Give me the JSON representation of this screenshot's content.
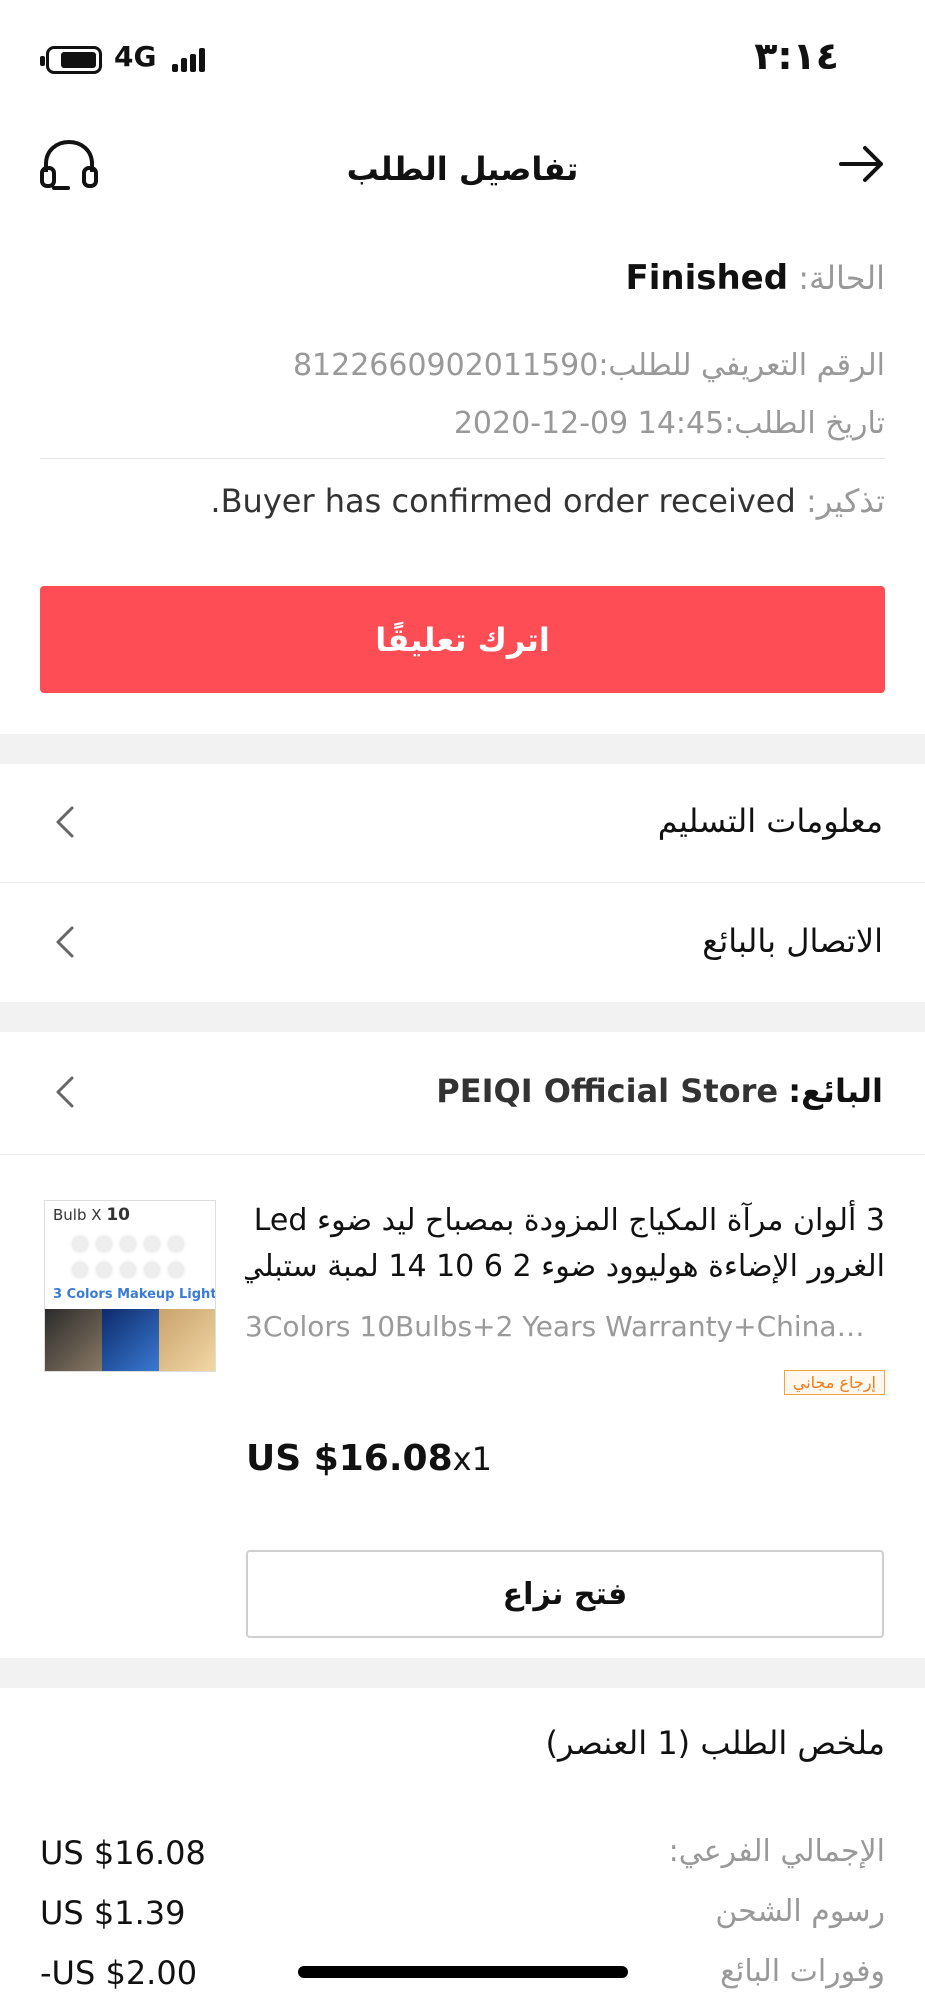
{
  "status_bar": {
    "network": "4G",
    "time": "٣:١٤"
  },
  "header": {
    "title": "تفاصيل الطلب"
  },
  "order": {
    "status_label": "الحالة:",
    "status_value": "Finished",
    "id_label": "الرقم التعريفي للطلب:",
    "id_value": "8122660902011590",
    "date_label": "تاريخ الطلب:",
    "date_value": "2020-12-09 14:45",
    "reminder_label": "تذكير:",
    "reminder_value": "Buyer has confirmed order received."
  },
  "actions": {
    "leave_feedback": "اترك تعليقًا",
    "open_dispute": "فتح نزاع"
  },
  "rows": {
    "delivery_info": "معلومات التسليم",
    "contact_seller": "الاتصال بالبائع"
  },
  "seller": {
    "label": "البائع:",
    "name": "PEIQI Official Store"
  },
  "product": {
    "image_label_prefix": "Bulb X",
    "image_label_count": "10",
    "image_colors_label": "3 Colors Makeup Light",
    "title_line1": "3 ألوان مرآة المكياج المزودة بمصباح ليد ضوء Led",
    "title_line2": "الغرور الإضاءة هوليوود ضوء 2 6 10 14 لمبة ستبلي...",
    "sku": "3Colors 10Bulbs+2 Years Warranty+China+P...",
    "badge": "إرجاع مجاني",
    "price": "US $16.08",
    "quantity": "x1"
  },
  "summary": {
    "title": "ملخص الطلب (1 العنصر)",
    "subtotal_label": "الإجمالي الفرعي:",
    "subtotal_value": "US $16.08",
    "shipping_label": "رسوم الشحن",
    "shipping_value": "US $1.39",
    "seller_discount_label": "وفورات البائع",
    "seller_discount_value": "-US $2.00"
  },
  "colors": {
    "accent": "#ff4d56",
    "muted_text": "#999999",
    "badge_border": "#f2a33a",
    "badge_text": "#f07a1a",
    "section_gap": "#f2f2f2"
  }
}
